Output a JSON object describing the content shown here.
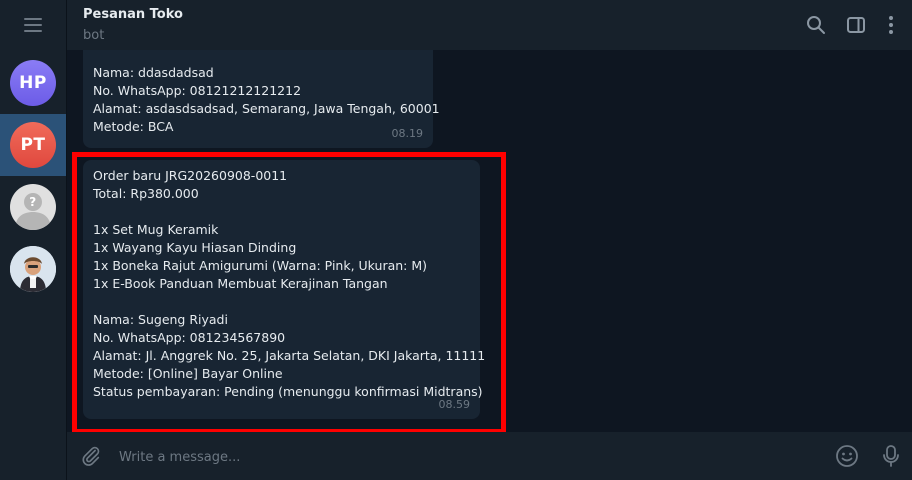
{
  "sidebar": {
    "chats": [
      {
        "initials": "HP",
        "color": "#7b6cf0"
      },
      {
        "initials": "PT",
        "color": "#e8574b",
        "active": true
      },
      {
        "initials": "",
        "color": "#d8d8d8"
      },
      {
        "initials": "",
        "color": "#dfe8f1"
      }
    ]
  },
  "header": {
    "title": "Pesanan Toko",
    "subtitle": "bot"
  },
  "messages": [
    {
      "lines": [
        "Nama: ddasdadsad",
        "No. WhatsApp: 08121212121212",
        "Alamat: asdasdsadsad, Semarang, Jawa Tengah, 60001",
        "Metode: BCA"
      ],
      "time": "08.19"
    },
    {
      "lines": [
        "Order baru JRG20260908-0011",
        "Total: Rp380.000",
        "",
        "1x Set Mug Keramik",
        "1x Wayang Kayu Hiasan Dinding",
        "1x Boneka Rajut Amigurumi (Warna: Pink, Ukuran: M)",
        "1x E-Book Panduan Membuat Kerajinan Tangan",
        "",
        "Nama: Sugeng Riyadi",
        "No. WhatsApp: 081234567890",
        "Alamat: Jl. Anggrek No. 25, Jakarta Selatan, DKI Jakarta, 11111",
        "Metode: [Online] Bayar Online",
        "Status pembayaran: Pending (menunggu konfirmasi Midtrans)"
      ],
      "time": "08.59"
    }
  ],
  "composer": {
    "placeholder": "Write a message..."
  },
  "colors": {
    "background": "#0e1621",
    "panel": "#17212b",
    "bubble": "#182533",
    "active_chat": "#2b5278",
    "highlight": "#ff0000"
  }
}
